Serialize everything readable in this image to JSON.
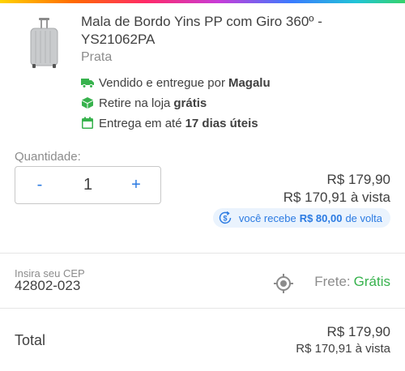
{
  "product": {
    "title": "Mala de Bordo Yins PP com Giro 360º - YS21062PA",
    "color": "Prata"
  },
  "features": [
    {
      "icon": "truck-icon",
      "text": "Vendido e entregue por",
      "bold": "Magalu"
    },
    {
      "icon": "package-icon",
      "text": "Retire na loja",
      "bold": "grátis"
    },
    {
      "icon": "calendar-icon",
      "text": "Entrega em até",
      "bold": "17 dias úteis"
    }
  ],
  "quantity": {
    "label": "Quantidade:",
    "minus": "-",
    "value": "1",
    "plus": "+"
  },
  "price": {
    "main": "R$ 179,90",
    "vista": "R$ 170,91 à vista"
  },
  "cashback": {
    "prefix": "você recebe",
    "amount": "R$ 80,00",
    "suffix": "de volta"
  },
  "cep": {
    "label": "Insira seu CEP",
    "value": "42802-023",
    "icon": "location-target-icon"
  },
  "shipping": {
    "label": "Frete:",
    "value": "Grátis"
  },
  "total": {
    "label": "Total",
    "price": "R$ 179,90",
    "vista": "R$ 170,91 à vista"
  },
  "colors": {
    "accent_blue": "#2a7ae2",
    "accent_green": "#37b24d",
    "cashback_bg": "#eaf3fd"
  }
}
